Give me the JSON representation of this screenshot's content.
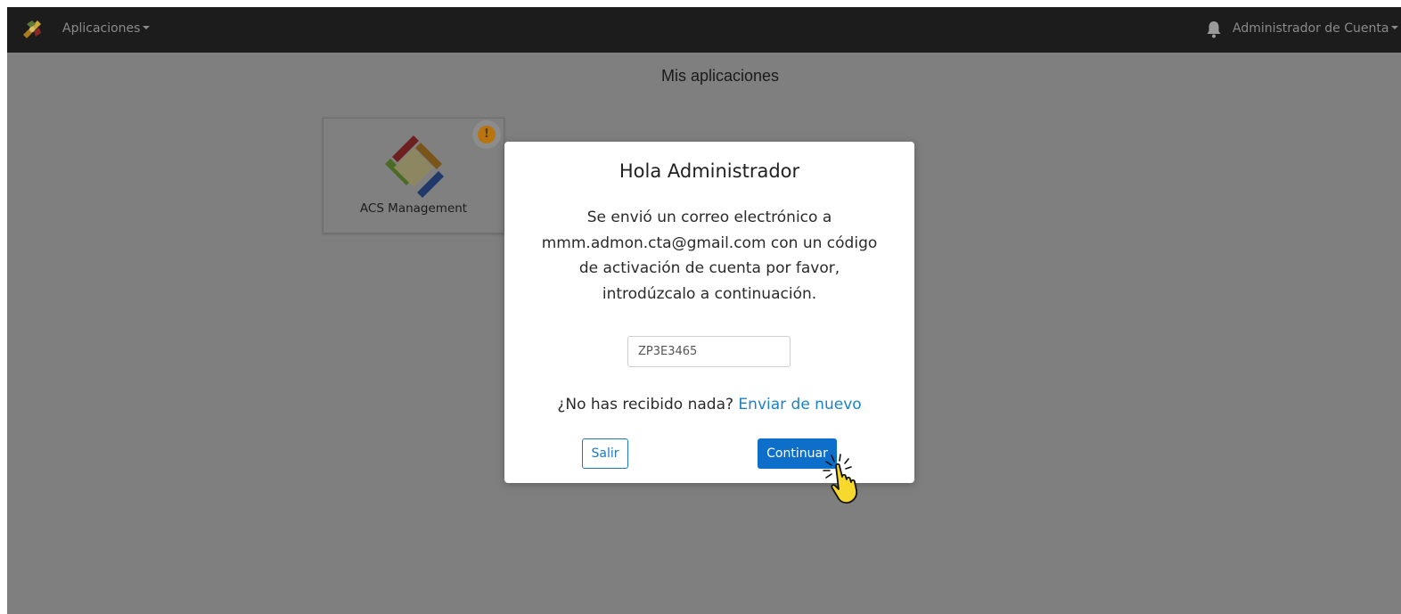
{
  "navbar": {
    "apps_label": "Aplicaciones",
    "account_label": "Administrador de Cuenta",
    "background": "#1c1c1c"
  },
  "page": {
    "title": "Mis aplicaciones"
  },
  "apps": [
    {
      "name": "ACS Management",
      "has_warning": true,
      "warning_symbol": "!"
    }
  ],
  "modal": {
    "title": "Hola Administrador",
    "message": "Se envió un correo electrónico a mmm.admon.cta@gmail.com con un código de activación de cuenta por favor, introdúzcalo a continuación.",
    "code_value": "ZP3E3465",
    "resend_prompt": "¿No has recibido nada?",
    "resend_link": "Enviar de nuevo",
    "exit_label": "Salir",
    "continue_label": "Continuar"
  },
  "colors": {
    "primary": "#0d6fc9",
    "link": "#1b82c7",
    "warning": "#e8961a",
    "overlay": "#7f7f7f"
  },
  "icons": {
    "app_logo": "diamond-logo-icon",
    "bell": "bell-icon",
    "warning": "exclamation-icon",
    "cursor": "hand-pointer-icon"
  }
}
